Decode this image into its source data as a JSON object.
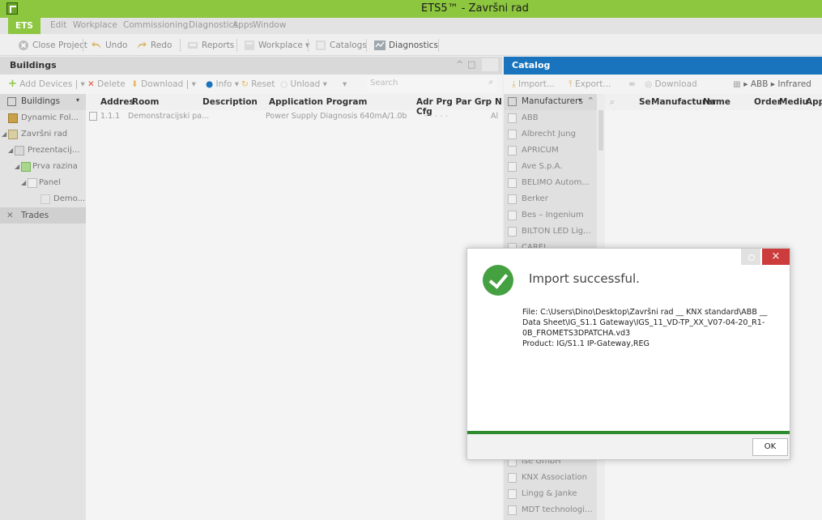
{
  "window": {
    "title": "ETS5™ - Završni rad"
  },
  "menu": {
    "ets": "ETS",
    "items": [
      "Edit",
      "Workplace",
      "Commissioning",
      "Diagnostics",
      "Apps",
      "Window"
    ]
  },
  "toolbar": {
    "close_project": "Close Project",
    "undo": "Undo",
    "redo": "Redo",
    "reports": "Reports",
    "workplace": "Workplace ▾",
    "catalogs": "Catalogs",
    "diagnostics": "Diagnostics"
  },
  "buildings": {
    "title": "Buildings",
    "tools": {
      "add_devices": "Add Devices",
      "delete": "Delete",
      "download": "Download",
      "info": "Info ▾",
      "reset": "Reset",
      "unload": "Unload ▾",
      "search_placeholder": "Search"
    },
    "tree_header": "Buildings",
    "tree": [
      {
        "label": "Dynamic Fol..."
      },
      {
        "label": "Završni rad"
      },
      {
        "label": "Prezentacij..."
      },
      {
        "label": "Prva razina"
      },
      {
        "label": "Panel"
      },
      {
        "label": "Demo..."
      }
    ],
    "trades": "Trades",
    "columns": [
      "Addres",
      "Room",
      "Description",
      "Application Program",
      "Adr Prg Par Grp Cfg",
      "N"
    ],
    "rows": [
      {
        "address": "1.1.1",
        "room": "Demonstracijski pa...",
        "description": "",
        "application": "Power Supply Diagnosis 640mA/1.0b",
        "flags": "- - - - -",
        "n": "Al"
      }
    ]
  },
  "catalog": {
    "title": "Catalog",
    "tools": {
      "import": "Import...",
      "export": "Export...",
      "download": "Download",
      "breadcrumb": "ABB ▸ Infrared"
    },
    "manufacturers_header": "Manufacturers",
    "manufacturers_top": [
      "ABB",
      "Albrecht Jung",
      "APRICUM",
      "Ave S.p.A.",
      "BELIMO Autom...",
      "Berker",
      "Bes – Ingenium",
      "BILTON LED Lig...",
      "CAREL"
    ],
    "manufacturers_bottom": [
      "ise GmbH",
      "KNX Association",
      "Lingg & Janke",
      "MDT technologi..."
    ],
    "columns": [
      "Se",
      "Manufacturer",
      "Name",
      "Order",
      "Mediu",
      "Appl"
    ]
  },
  "dialog": {
    "heading": "Import successful.",
    "file_line": "File: C:\\Users\\Dino\\Desktop\\Završni rad __ KNX standard\\ABB __ Data Sheet\\IG_S1.1 Gateway\\IGS_11_VD-TP_XX_V07-04-20_R1-0B_FROMETS3DPATCHA.vd3",
    "product_line": "Product: IG/S1.1 IP-Gateway,REG",
    "ok": "OK",
    "close": "×"
  }
}
